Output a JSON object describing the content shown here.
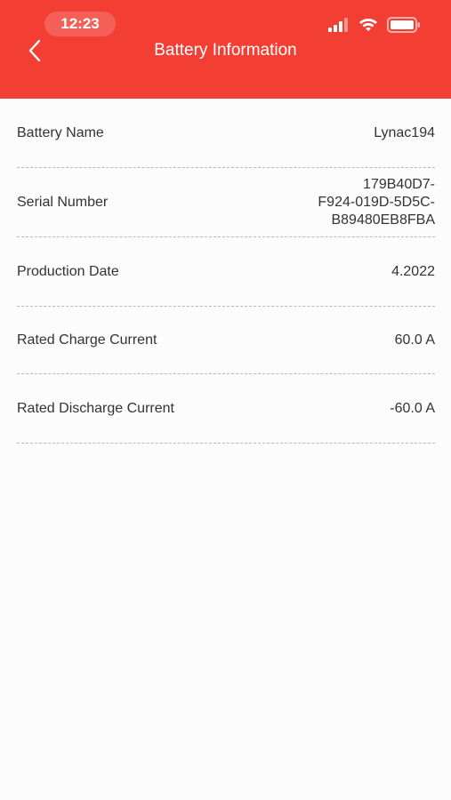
{
  "status_bar": {
    "time": "12:23"
  },
  "header": {
    "title": "Battery Information",
    "back_icon": "chevron-left-icon"
  },
  "rows": [
    {
      "label": "Battery Name",
      "value": "Lynac194"
    },
    {
      "label": "Serial Number",
      "value_lines": [
        "179B40D7-",
        "F924-019D-5D5C-",
        "B89480EB8FBA"
      ]
    },
    {
      "label": "Production Date",
      "value": "4.2022"
    },
    {
      "label": "Rated Charge Current",
      "value": "60.0 A"
    },
    {
      "label": "Rated Discharge Current",
      "value": "-60.0 A"
    }
  ],
  "colors": {
    "header_bg": "#f23e33",
    "divider": "#b9b9b9",
    "text": "#333333"
  }
}
